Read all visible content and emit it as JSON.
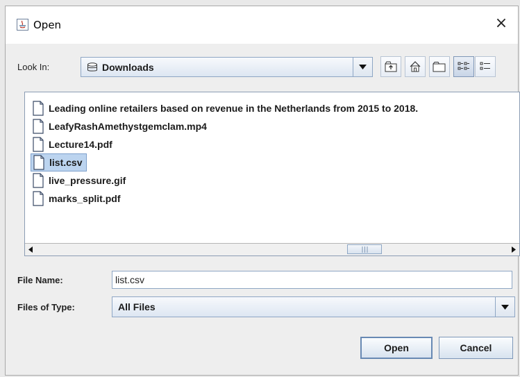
{
  "dialog": {
    "title": "Open",
    "close_symbol": "×"
  },
  "look_in": {
    "label": "Look In:",
    "value": "Downloads",
    "value_icon": "drive-icon",
    "toolbar": [
      "up-one-level-icon",
      "home-icon",
      "new-folder-icon",
      "list-view-icon",
      "details-view-icon"
    ]
  },
  "files": [
    {
      "name": "Leading online retailers based on revenue in the Netherlands from 2015 to 2018.",
      "selected": false
    },
    {
      "name": "LeafyRashAmethystgemclam.mp4",
      "selected": false
    },
    {
      "name": "Lecture14.pdf",
      "selected": false
    },
    {
      "name": "list.csv",
      "selected": true
    },
    {
      "name": "live_pressure.gif",
      "selected": false
    },
    {
      "name": "marks_split.pdf",
      "selected": false
    }
  ],
  "file_name": {
    "label": "File Name:",
    "value": "list.csv"
  },
  "file_type": {
    "label": "Files of Type:",
    "value": "All Files"
  },
  "buttons": {
    "open": "Open",
    "cancel": "Cancel"
  },
  "colors": {
    "selection": "#bcd4ef",
    "accent_border": "#8ea6c4"
  }
}
